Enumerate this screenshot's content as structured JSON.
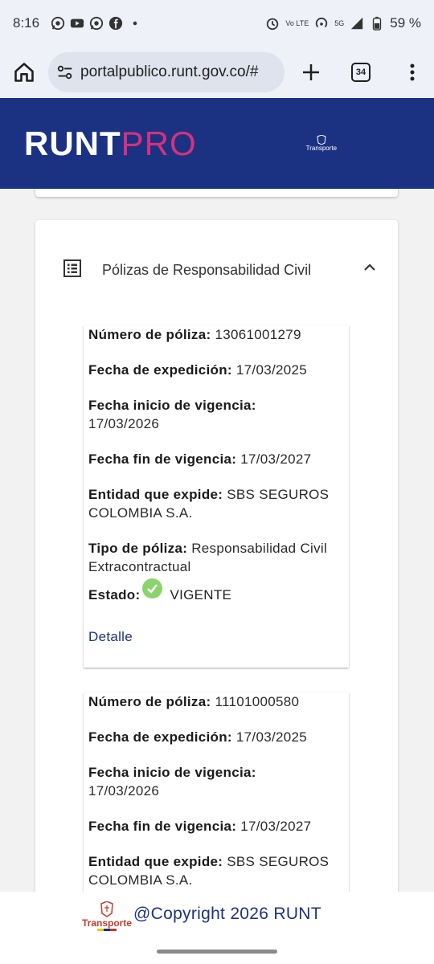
{
  "status_bar": {
    "time": "8:16",
    "battery": "59 %",
    "volte": "Vo LTE",
    "network": "5G"
  },
  "browser": {
    "url": "portalpublico.runt.gov.co/#",
    "tab_count": "34"
  },
  "header": {
    "logo_runt": "RUNT",
    "logo_pro": "PRO",
    "ministry_label": "Transporte"
  },
  "section": {
    "title": "Pólizas de Responsabilidad Civil"
  },
  "labels": {
    "numero": "Número de póliza:",
    "expedicion": "Fecha de expedición:",
    "inicio": "Fecha inicio de vigencia:",
    "fin": "Fecha fin de vigencia:",
    "entidad": "Entidad que expide:",
    "tipo": "Tipo de póliza:",
    "estado": "Estado:",
    "detalle": "Detalle"
  },
  "policies": [
    {
      "numero": "13061001279",
      "expedicion": "17/03/2025",
      "inicio": "17/03/2026",
      "fin": "17/03/2027",
      "entidad": "SBS SEGUROS COLOMBIA S.A.",
      "tipo": "Responsabilidad Civil Extracontractual",
      "estado": "VIGENTE"
    },
    {
      "numero": "11101000580",
      "expedicion": "17/03/2025",
      "inicio": "17/03/2026",
      "fin": "17/03/2027",
      "entidad": "SBS SEGUROS COLOMBIA S.A."
    }
  ],
  "footer": {
    "logo_text": "Transporte",
    "copyright": "@Copyright 2026 RUNT"
  },
  "colors": {
    "brand_blue": "#1b3282",
    "brand_pink": "#d6307f",
    "status_ok": "#8bd36b"
  }
}
